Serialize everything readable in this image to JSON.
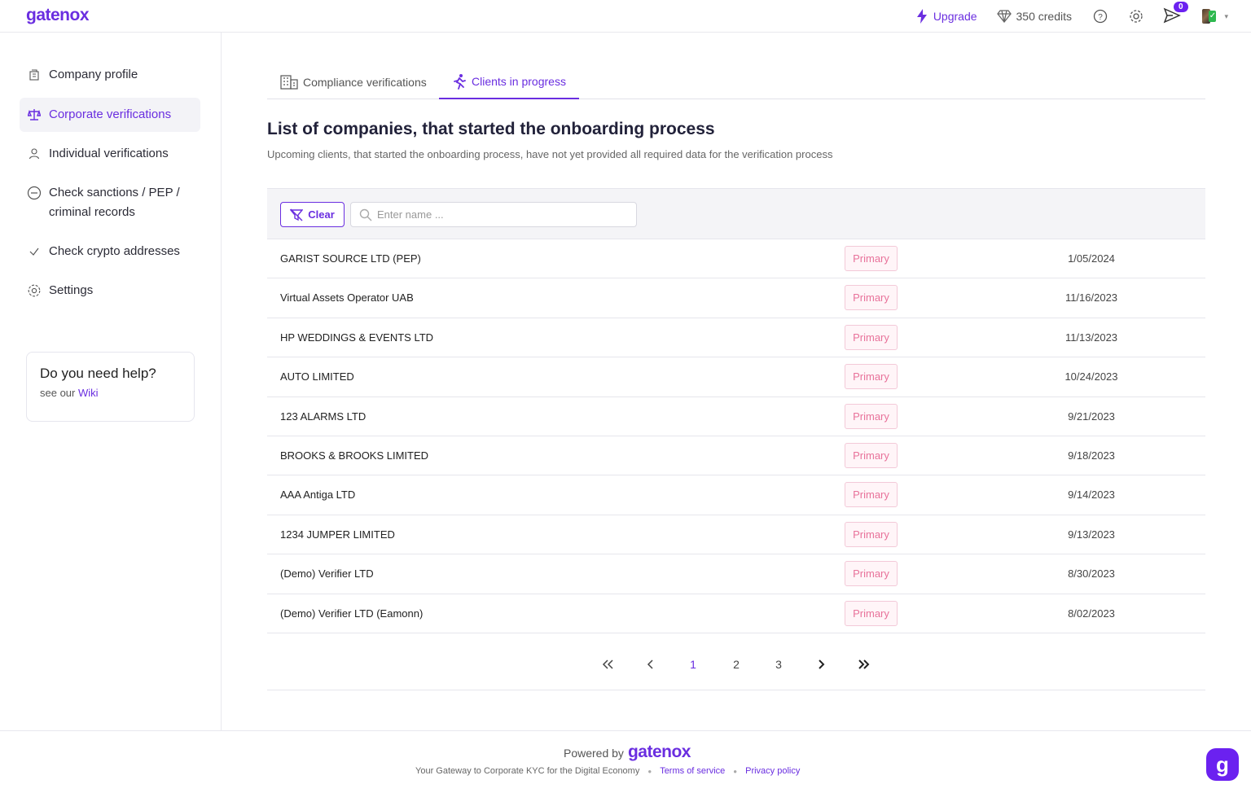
{
  "app": {
    "logo": "gatenox"
  },
  "topbar": {
    "upgrade_label": "Upgrade",
    "credits_label": "350 credits",
    "notification_count": "0"
  },
  "sidebar": {
    "items": [
      {
        "label": "Company profile",
        "icon": "building-icon"
      },
      {
        "label": "Corporate verifications",
        "icon": "scale-icon"
      },
      {
        "label": "Individual verifications",
        "icon": "user-icon"
      },
      {
        "label": "Check sanctions / PEP / criminal records",
        "icon": "minus-circle-icon"
      },
      {
        "label": "Check crypto addresses",
        "icon": "check-icon"
      },
      {
        "label": "Settings",
        "icon": "gear-icon"
      }
    ],
    "help": {
      "title": "Do you need help?",
      "prefix": "see our",
      "link": "Wiki"
    }
  },
  "tabs": [
    {
      "label": "Compliance verifications"
    },
    {
      "label": "Clients in progress"
    }
  ],
  "main": {
    "title": "List of companies, that started the onboarding process",
    "subtitle": "Upcoming clients, that started the onboarding process, have not yet provided all required data for the verification process",
    "clear_label": "Clear",
    "search_placeholder": "Enter name ..."
  },
  "rows": [
    {
      "name": "GARIST SOURCE LTD (PEP)",
      "tag": "Primary",
      "date": "1/05/2024"
    },
    {
      "name": "Virtual Assets Operator UAB",
      "tag": "Primary",
      "date": "11/16/2023"
    },
    {
      "name": "HP WEDDINGS & EVENTS LTD",
      "tag": "Primary",
      "date": "11/13/2023"
    },
    {
      "name": "AUTO LIMITED",
      "tag": "Primary",
      "date": "10/24/2023"
    },
    {
      "name": "123 ALARMS LTD",
      "tag": "Primary",
      "date": "9/21/2023"
    },
    {
      "name": "BROOKS & BROOKS LIMITED",
      "tag": "Primary",
      "date": "9/18/2023"
    },
    {
      "name": "AAA Antiga LTD",
      "tag": "Primary",
      "date": "9/14/2023"
    },
    {
      "name": "1234 JUMPER LIMITED",
      "tag": "Primary",
      "date": "9/13/2023"
    },
    {
      "name": "(Demo) Verifier LTD",
      "tag": "Primary",
      "date": "8/30/2023"
    },
    {
      "name": "(Demo) Verifier LTD (Eamonn)",
      "tag": "Primary",
      "date": "8/02/2023"
    }
  ],
  "pagination": {
    "first": "«",
    "prev": "‹",
    "pages": [
      "1",
      "2",
      "3"
    ],
    "current": "1",
    "next": "›",
    "last": "»"
  },
  "footer": {
    "powered_by": "Powered by",
    "brand": "gatenox",
    "tagline": "Your Gateway to Corporate KYC for the Digital Economy",
    "terms": "Terms of service",
    "privacy": "Privacy policy"
  },
  "chat_button": "g"
}
